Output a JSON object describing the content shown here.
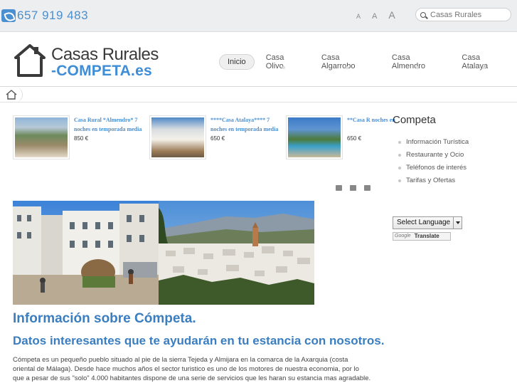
{
  "topbar": {
    "phone": "657 919 483",
    "font_small": "A",
    "font_medium": "A",
    "font_large": "A",
    "search_placeholder": "Casas Rurales"
  },
  "logo": {
    "line1": "Casas Rurales",
    "line2": "-COMPETA.es"
  },
  "nav": {
    "items": [
      {
        "label": "Inicio"
      },
      {
        "label": "Casa Olivo"
      },
      {
        "label": "Casa Algarrobo"
      },
      {
        "label": "Casa Almendro"
      },
      {
        "label": "Casa Atalaya"
      }
    ]
  },
  "featured": [
    {
      "title": "Casa Rural *Almendro* 7 noches en temporada media",
      "price": "850 €"
    },
    {
      "title": "****Casa Atalaya**** 7 noches en temporada media",
      "price": "650 €"
    },
    {
      "title": "**Casa R noches en",
      "price": "650 €"
    }
  ],
  "article": {
    "title": "Información sobre Cómpeta.",
    "subtitle": "Datos interesantes que te ayudarán en tu estancia con nosotros.",
    "body": "Cómpeta es un pequeño pueblo situado al pie de la sierra Tejeda y Almijara en la comarca de la Axarquia (costa oriental de Málaga). Desde hace muchos años el sector turistico es uno de los motores de nuestra economia, por lo que a pesar de sus \"solo\" 4.000 habitantes dispone de una serie de servicios que les haran su estancia mas agradable."
  },
  "sidebar": {
    "title": "Competa",
    "items": [
      {
        "label": "Información Turística"
      },
      {
        "label": "Restaurante y Ocio"
      },
      {
        "label": "Teléfonos de interés"
      },
      {
        "label": "Tarifas y Ofertas"
      }
    ],
    "language_select": "Select Language",
    "google_label": "Google",
    "translate_label": "Translate"
  },
  "colors": {
    "accent": "#3a7ec0",
    "link": "#4a8fd0",
    "topbar_bg": "#edeeef"
  }
}
